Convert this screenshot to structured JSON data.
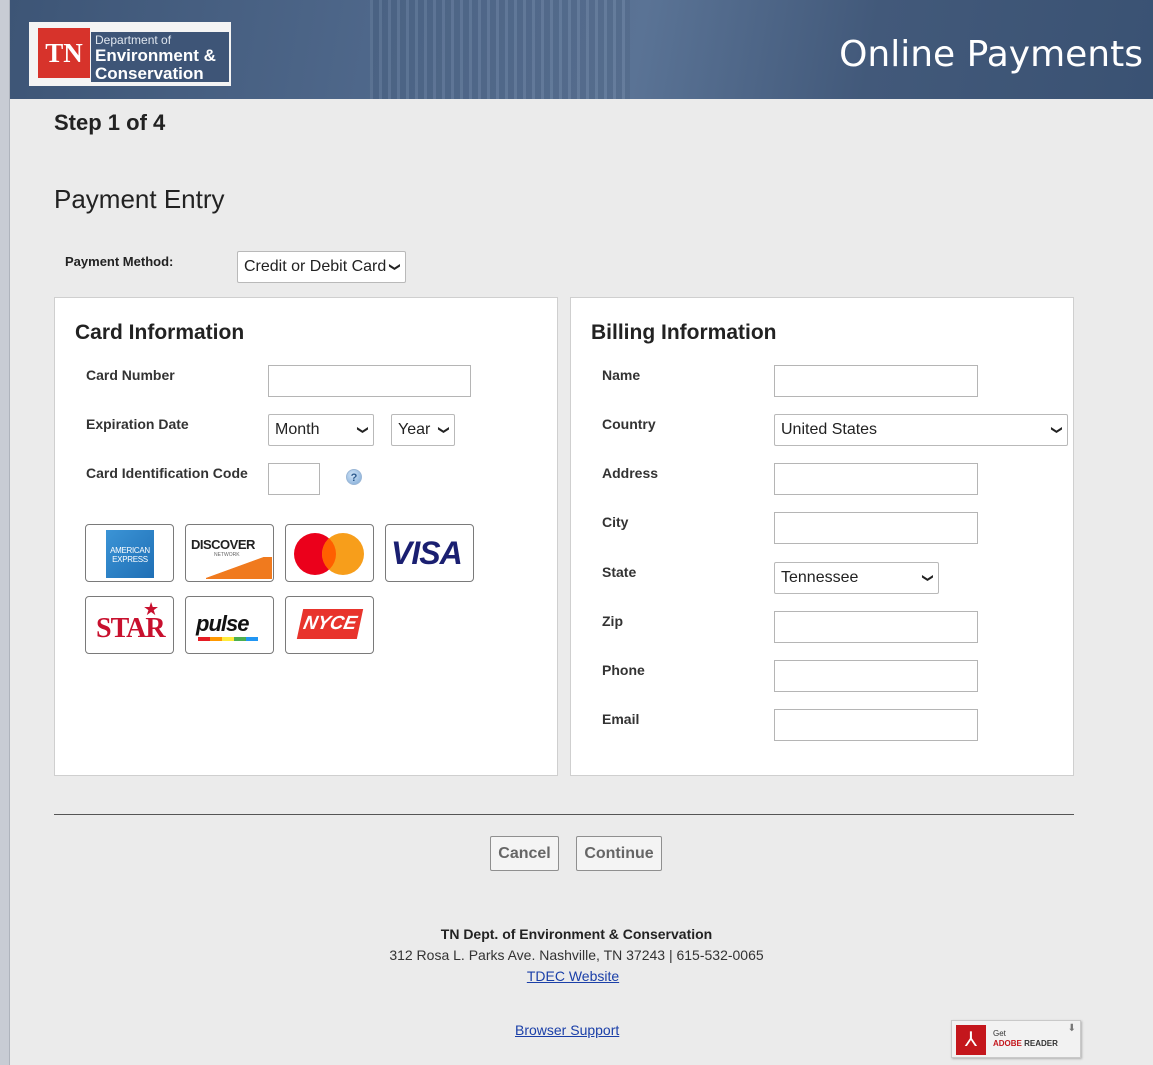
{
  "header": {
    "logo_abbr": "TN",
    "logo_line1": "Department of",
    "logo_line2": "Environment &",
    "logo_line3": "Conservation",
    "title": "Online Payments"
  },
  "step": "Step 1 of 4",
  "page_title": "Payment Entry",
  "payment_method": {
    "label": "Payment Method:",
    "value": "Credit or Debit Card"
  },
  "card_info": {
    "title": "Card Information",
    "card_number_label": "Card Number",
    "card_number_value": "",
    "expiration_label": "Expiration Date",
    "month_value": "Month",
    "year_value": "Year",
    "cic_label": "Card Identification Code",
    "cic_value": "",
    "help_icon": "help-icon",
    "cards": {
      "amex": "AMERICAN EXPRESS",
      "discover": "DISCOVER",
      "discover_sub": "NETWORK",
      "visa": "VISA",
      "star": "STAR",
      "pulse": "pulse",
      "nyce": "NYCE"
    }
  },
  "billing_info": {
    "title": "Billing Information",
    "name_label": "Name",
    "name_value": "",
    "country_label": "Country",
    "country_value": "United States",
    "address_label": "Address",
    "address_value": "",
    "city_label": "City",
    "city_value": "",
    "state_label": "State",
    "state_value": "Tennessee",
    "zip_label": "Zip",
    "zip_value": "",
    "phone_label": "Phone",
    "phone_value": "",
    "email_label": "Email",
    "email_value": ""
  },
  "buttons": {
    "cancel": "Cancel",
    "continue": "Continue"
  },
  "footer": {
    "org_name": "TN Dept. of Environment & Conservation",
    "address": "312 Rosa L. Parks Ave. Nashville, TN 37243 | 615-532-0065",
    "tdec_link": "TDEC Website",
    "browser_support": "Browser Support",
    "adobe_get": "Get",
    "adobe_brand": "ADOBE",
    "adobe_reader": "READER"
  },
  "colors": {
    "header_bg": "#4a6285",
    "logo_red": "#d7332b",
    "link": "#1a3fa8",
    "page_bg": "#ebebeb"
  }
}
